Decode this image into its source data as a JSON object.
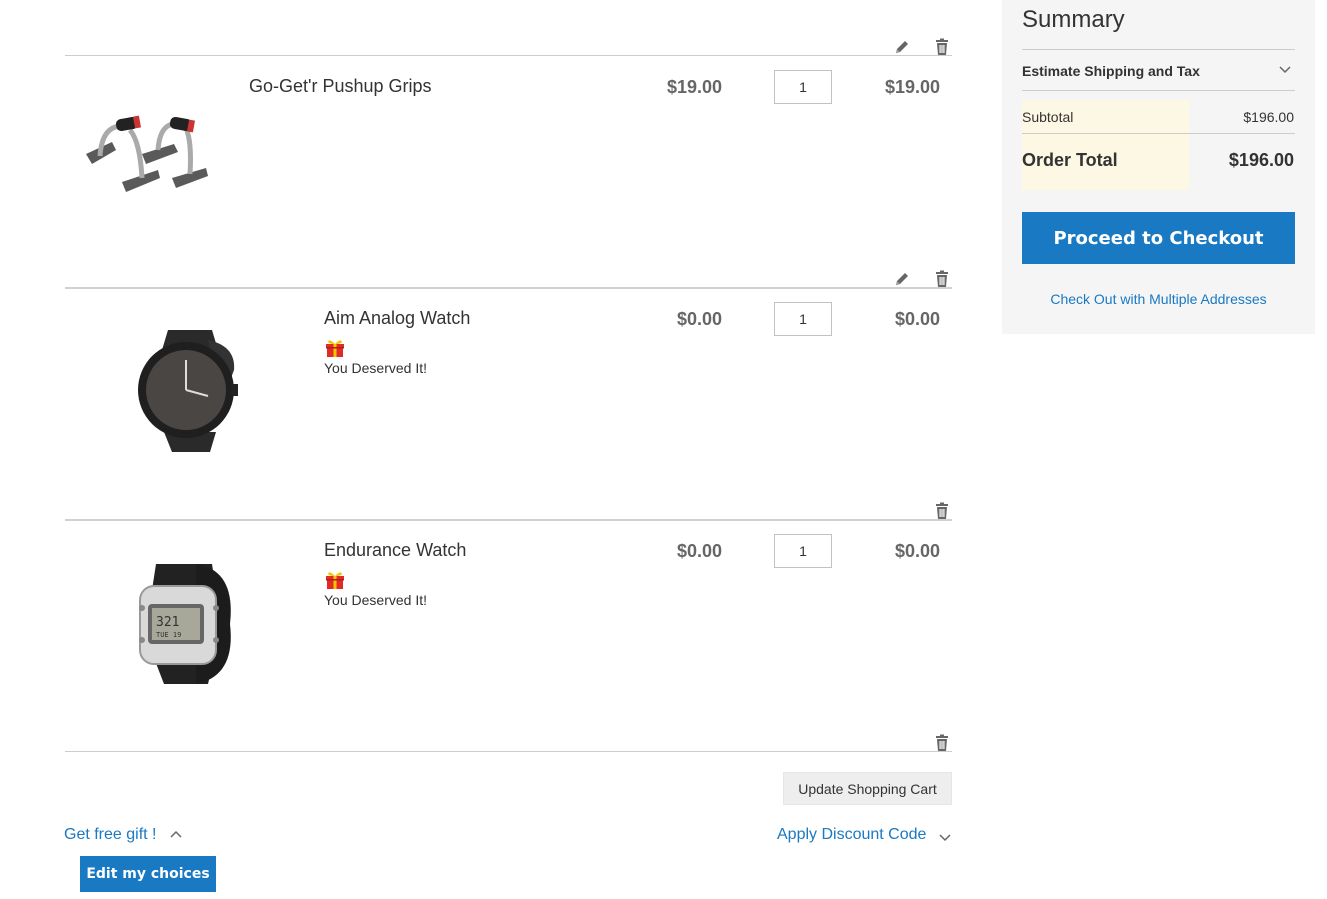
{
  "cart": {
    "items": [
      {
        "name": "Go-Get'r Pushup Grips",
        "price": "$19.00",
        "qty": "1",
        "subtotal": "$19.00",
        "gift_label": ""
      },
      {
        "name": "Aim Analog Watch",
        "price": "$0.00",
        "qty": "1",
        "subtotal": "$0.00",
        "gift_label": "You Deserved It!"
      },
      {
        "name": "Endurance Watch",
        "price": "$0.00",
        "qty": "1",
        "subtotal": "$0.00",
        "gift_label": "You Deserved It!"
      }
    ],
    "update_button": "Update Shopping Cart",
    "free_gift_link": "Get free gift !",
    "edit_choices_button": "Edit my choices",
    "discount_link": "Apply Discount Code"
  },
  "summary": {
    "title": "Summary",
    "shipping_label": "Estimate Shipping and Tax",
    "subtotal_label": "Subtotal",
    "subtotal_value": "$196.00",
    "order_total_label": "Order Total",
    "order_total_value": "$196.00",
    "checkout_button": "Proceed to Checkout",
    "multi_address_link": "Check Out with Multiple Addresses"
  },
  "icons": {
    "edit": "pencil-icon",
    "delete": "trash-icon",
    "gift": "gift-icon",
    "chevron": "chevron-icon"
  },
  "colors": {
    "accent": "#1979c3",
    "summary_bg": "#f5f5f5",
    "totals_highlight": "#fdf8e4",
    "gift_red": "#e02b27",
    "gift_yellow": "#f5c400"
  }
}
